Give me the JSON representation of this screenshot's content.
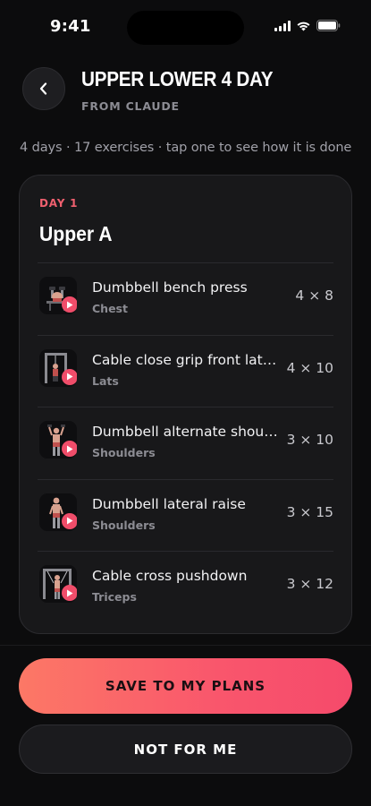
{
  "status_bar": {
    "time": "9:41"
  },
  "header": {
    "title": "UPPER LOWER 4 DAY",
    "source": "FROM CLAUDE",
    "summary": "4 days · 17 exercises · tap one to see how it is done"
  },
  "day": {
    "label": "DAY 1",
    "name": "Upper A",
    "exercises": [
      {
        "name": "Dumbbell bench press",
        "muscle": "Chest",
        "sets": "4 × 8"
      },
      {
        "name": "Cable close grip front lat p...",
        "muscle": "Lats",
        "sets": "4 × 10"
      },
      {
        "name": "Dumbbell alternate should...",
        "muscle": "Shoulders",
        "sets": "3 × 10"
      },
      {
        "name": "Dumbbell lateral raise",
        "muscle": "Shoulders",
        "sets": "3 × 15"
      },
      {
        "name": "Cable cross pushdown",
        "muscle": "Triceps",
        "sets": "3 × 12"
      }
    ]
  },
  "actions": {
    "save_label": "SAVE TO MY PLANS",
    "dismiss_label": "NOT FOR ME"
  },
  "colors": {
    "accent": "#f9566c",
    "background": "#0c0c0d",
    "card": "#18181a",
    "day_label": "#f0606f"
  },
  "icons": {
    "back": "chevron-left-icon",
    "play": "play-icon",
    "signal": "cellular-signal-icon",
    "wifi": "wifi-icon",
    "battery": "battery-icon"
  }
}
